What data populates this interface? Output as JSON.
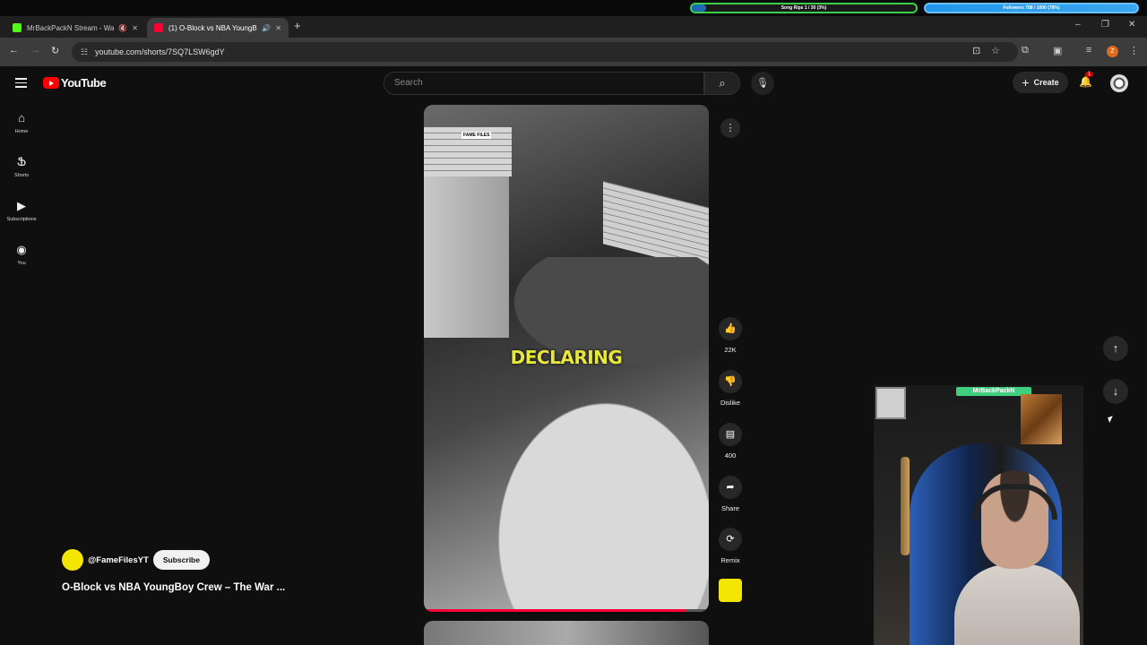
{
  "overlay": {
    "song_goal": "Song Rips 1 / 30 (3%)",
    "follower_goal": "Followers 788 / 1000 (78%)"
  },
  "tabs": [
    {
      "title": "MrBackPackN Stream - Wa",
      "fav_color": "#53fc18"
    },
    {
      "title": "(1) O-Block vs NBA YoungB",
      "fav_color": "#ff0033"
    }
  ],
  "browser": {
    "url": "youtube.com/shorts/7SQ7LSW6gdY",
    "profile_letter": "Z"
  },
  "youtube": {
    "logo_text": "YouTube",
    "search_placeholder": "Search",
    "create_label": "Create",
    "notification_count": "1",
    "sidebar": [
      {
        "label": "Home",
        "icon": "home-icon"
      },
      {
        "label": "Shorts",
        "icon": "shorts-icon"
      },
      {
        "label": "Subscriptions",
        "icon": "subscriptions-icon"
      },
      {
        "label": "You",
        "icon": "you-icon"
      }
    ]
  },
  "short": {
    "watermark": "FAME FILES",
    "caption": "DECLARING",
    "progress_fraction": 0.92,
    "actions": {
      "likes": "22K",
      "dislike": "Dislike",
      "comments": "400",
      "share": "Share",
      "remix": "Remix"
    },
    "channel": "@FameFilesYT",
    "subscribe_label": "Subscribe",
    "title": "O-Block vs NBA YoungBoy Crew – The War ..."
  },
  "webcam": {
    "sign_text": "MrBackPackN"
  },
  "colors": {
    "accent": "#ff0033",
    "caption": "#e8e83c",
    "channel_brand": "#f2e600"
  }
}
